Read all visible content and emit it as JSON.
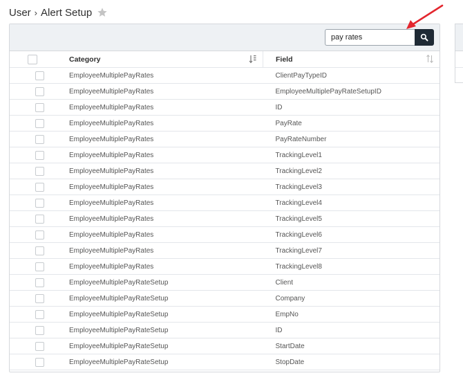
{
  "breadcrumb": {
    "parent": "User",
    "separator": "›",
    "current": "Alert Setup"
  },
  "icons": {
    "favorite": "star-icon",
    "search": "magnifier-icon",
    "sort_category": "sort-descending-icon",
    "sort_field": "sort-unsorted-icon",
    "annotation": "red-arrow-icon"
  },
  "colors": {
    "search_button": "#1f2a35",
    "toolbar_bg": "#eef1f4",
    "annotation_arrow": "#e3262e",
    "star": "#c4c4c4"
  },
  "search": {
    "value": "pay rates",
    "placeholder": ""
  },
  "table": {
    "headers": {
      "category": "Category",
      "field": "Field"
    },
    "rows": [
      {
        "category": "EmployeeMultiplePayRates",
        "field": "ClientPayTypeID"
      },
      {
        "category": "EmployeeMultiplePayRates",
        "field": "EmployeeMultiplePayRateSetupID"
      },
      {
        "category": "EmployeeMultiplePayRates",
        "field": "ID"
      },
      {
        "category": "EmployeeMultiplePayRates",
        "field": "PayRate"
      },
      {
        "category": "EmployeeMultiplePayRates",
        "field": "PayRateNumber"
      },
      {
        "category": "EmployeeMultiplePayRates",
        "field": "TrackingLevel1"
      },
      {
        "category": "EmployeeMultiplePayRates",
        "field": "TrackingLevel2"
      },
      {
        "category": "EmployeeMultiplePayRates",
        "field": "TrackingLevel3"
      },
      {
        "category": "EmployeeMultiplePayRates",
        "field": "TrackingLevel4"
      },
      {
        "category": "EmployeeMultiplePayRates",
        "field": "TrackingLevel5"
      },
      {
        "category": "EmployeeMultiplePayRates",
        "field": "TrackingLevel6"
      },
      {
        "category": "EmployeeMultiplePayRates",
        "field": "TrackingLevel7"
      },
      {
        "category": "EmployeeMultiplePayRates",
        "field": "TrackingLevel8"
      },
      {
        "category": "EmployeeMultiplePayRateSetup",
        "field": "Client"
      },
      {
        "category": "EmployeeMultiplePayRateSetup",
        "field": "Company"
      },
      {
        "category": "EmployeeMultiplePayRateSetup",
        "field": "EmpNo"
      },
      {
        "category": "EmployeeMultiplePayRateSetup",
        "field": "ID"
      },
      {
        "category": "EmployeeMultiplePayRateSetup",
        "field": "StartDate"
      },
      {
        "category": "EmployeeMultiplePayRateSetup",
        "field": "StopDate"
      }
    ]
  }
}
